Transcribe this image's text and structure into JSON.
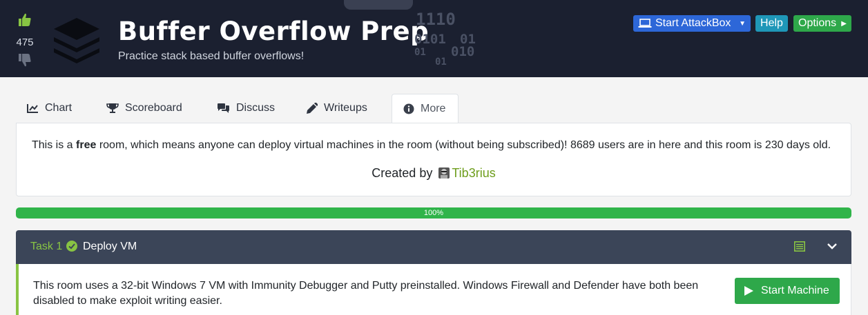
{
  "header": {
    "upvotes": "475",
    "title": "Buffer Overflow Prep",
    "subtitle": "Practice stack based buffer overflows!",
    "binary_lines": [
      "1110",
      "0101",
      "01",
      "01",
      "010",
      "01"
    ],
    "buttons": {
      "attackbox": "Start AttackBox",
      "help": "Help",
      "options": "Options"
    }
  },
  "tabs": [
    {
      "label": "Chart",
      "icon": "chart-line-icon"
    },
    {
      "label": "Scoreboard",
      "icon": "trophy-icon"
    },
    {
      "label": "Discuss",
      "icon": "comments-icon"
    },
    {
      "label": "Writeups",
      "icon": "pen-icon"
    },
    {
      "label": "More",
      "icon": "info-circle-icon",
      "active": true
    }
  ],
  "info": {
    "text_before": "This is a ",
    "free_word": "free",
    "text_after": " room, which means anyone can deploy virtual machines in the room (without being subscribed)! 8689 users are in here and this room is 230 days old.",
    "created_by_label": "Created by",
    "author": "Tib3rius"
  },
  "progress": {
    "value": 1.0,
    "label": "100%"
  },
  "task": {
    "number_label": "Task 1",
    "name": "Deploy VM",
    "completed": true,
    "body": "This room uses a 32-bit Windows 7 VM with Immunity Debugger and Putty preinstalled. Windows Firewall and Defender have both been disabled to make exploit writing easier.",
    "start_button": "Start Machine"
  },
  "colors": {
    "header_bg": "#1b2030",
    "accent_green": "#88c443",
    "button_green": "#2ea84a",
    "button_blue": "#2d67d8",
    "button_teal": "#1f97b8",
    "task_header_bg": "#3b4558"
  }
}
